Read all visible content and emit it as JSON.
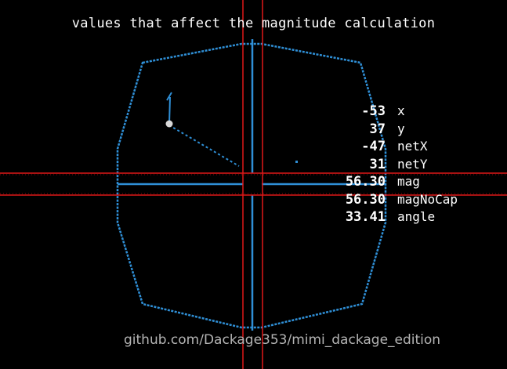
{
  "title": "values that affect the magnitude calculation",
  "footer": "github.com/Dackage353/mimi_dackage_edition",
  "readouts": [
    {
      "value": "-53",
      "label": "x"
    },
    {
      "value": "37",
      "label": "y"
    },
    {
      "value": "-47",
      "label": "netX"
    },
    {
      "value": "31",
      "label": "netY"
    },
    {
      "value": "56.30",
      "label": "mag"
    },
    {
      "value": "56.30",
      "label": "magNoCap"
    },
    {
      "value": "33.41",
      "label": "angle"
    }
  ],
  "colors": {
    "background": "#000000",
    "gate_outline": "#2f8fd6",
    "crosshair": "#e01818",
    "text": "#ffffff",
    "footer": "#b4b4b4"
  }
}
